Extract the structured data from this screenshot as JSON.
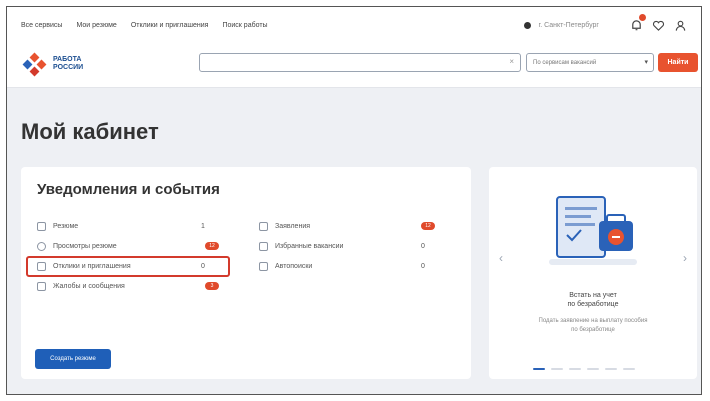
{
  "topnav": {
    "items": [
      "Все сервисы",
      "Мои резюме",
      "Отклики и приглашения",
      "Поиск работы"
    ],
    "city": "г. Санкт-Петербург"
  },
  "header": {
    "logo_line1": "РАБОТА",
    "logo_line2": "РОССИИ",
    "search_placeholder": "",
    "region_label": "По сервисам вакансий",
    "find_label": "Найти"
  },
  "page": {
    "title": "Мой кабинет"
  },
  "notifications": {
    "title": "Уведомления и события",
    "left": [
      {
        "label": "Резюме",
        "count": "1",
        "badge": ""
      },
      {
        "label": "Просмотры резюме",
        "count": "",
        "badge": "12"
      },
      {
        "label": "Отклики и приглашения",
        "count": "0",
        "badge": ""
      },
      {
        "label": "Жалобы и сообщения",
        "count": "",
        "badge": "3"
      }
    ],
    "right": [
      {
        "label": "Заявления",
        "count": "",
        "badge": "12"
      },
      {
        "label": "Избранные вакансии",
        "count": "0",
        "badge": ""
      },
      {
        "label": "Автопоиски",
        "count": "0",
        "badge": ""
      }
    ],
    "create_button": "Создать резюме"
  },
  "promo": {
    "title_line1": "Встать на учет",
    "title_line2": "по безработице",
    "desc_line1": "Подать заявление на выплату пособия",
    "desc_line2": "по безработице",
    "slides": 6,
    "active_slide": 1
  },
  "colors": {
    "accent": "#e8532f",
    "primary": "#1f5fb8",
    "highlight": "#d33a2c"
  }
}
